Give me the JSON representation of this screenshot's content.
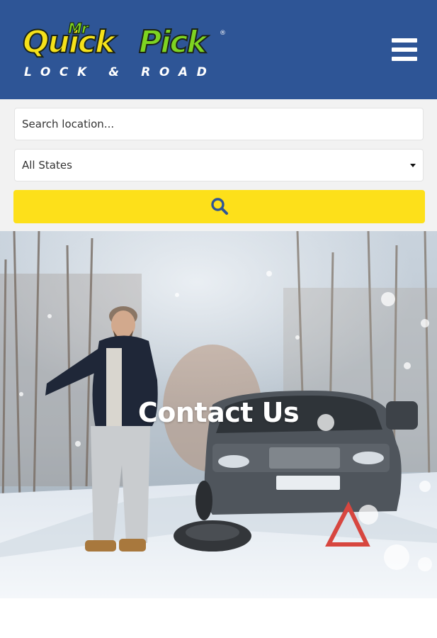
{
  "header": {
    "logo": {
      "prefix": "Mr",
      "word_quick": "Quick",
      "word_pick": "Pick",
      "registered": "®",
      "tagline": "LOCK & ROAD"
    },
    "menu_icon": "hamburger-menu-icon"
  },
  "search": {
    "location_placeholder": "Search location...",
    "state_selected": "All States",
    "search_icon": "magnifier-icon"
  },
  "hero": {
    "title": "Contact Us"
  },
  "colors": {
    "header_bg": "#2e5596",
    "accent_yellow": "#fde01a",
    "logo_green": "#7ed321",
    "logo_yellow": "#f5e11a"
  }
}
